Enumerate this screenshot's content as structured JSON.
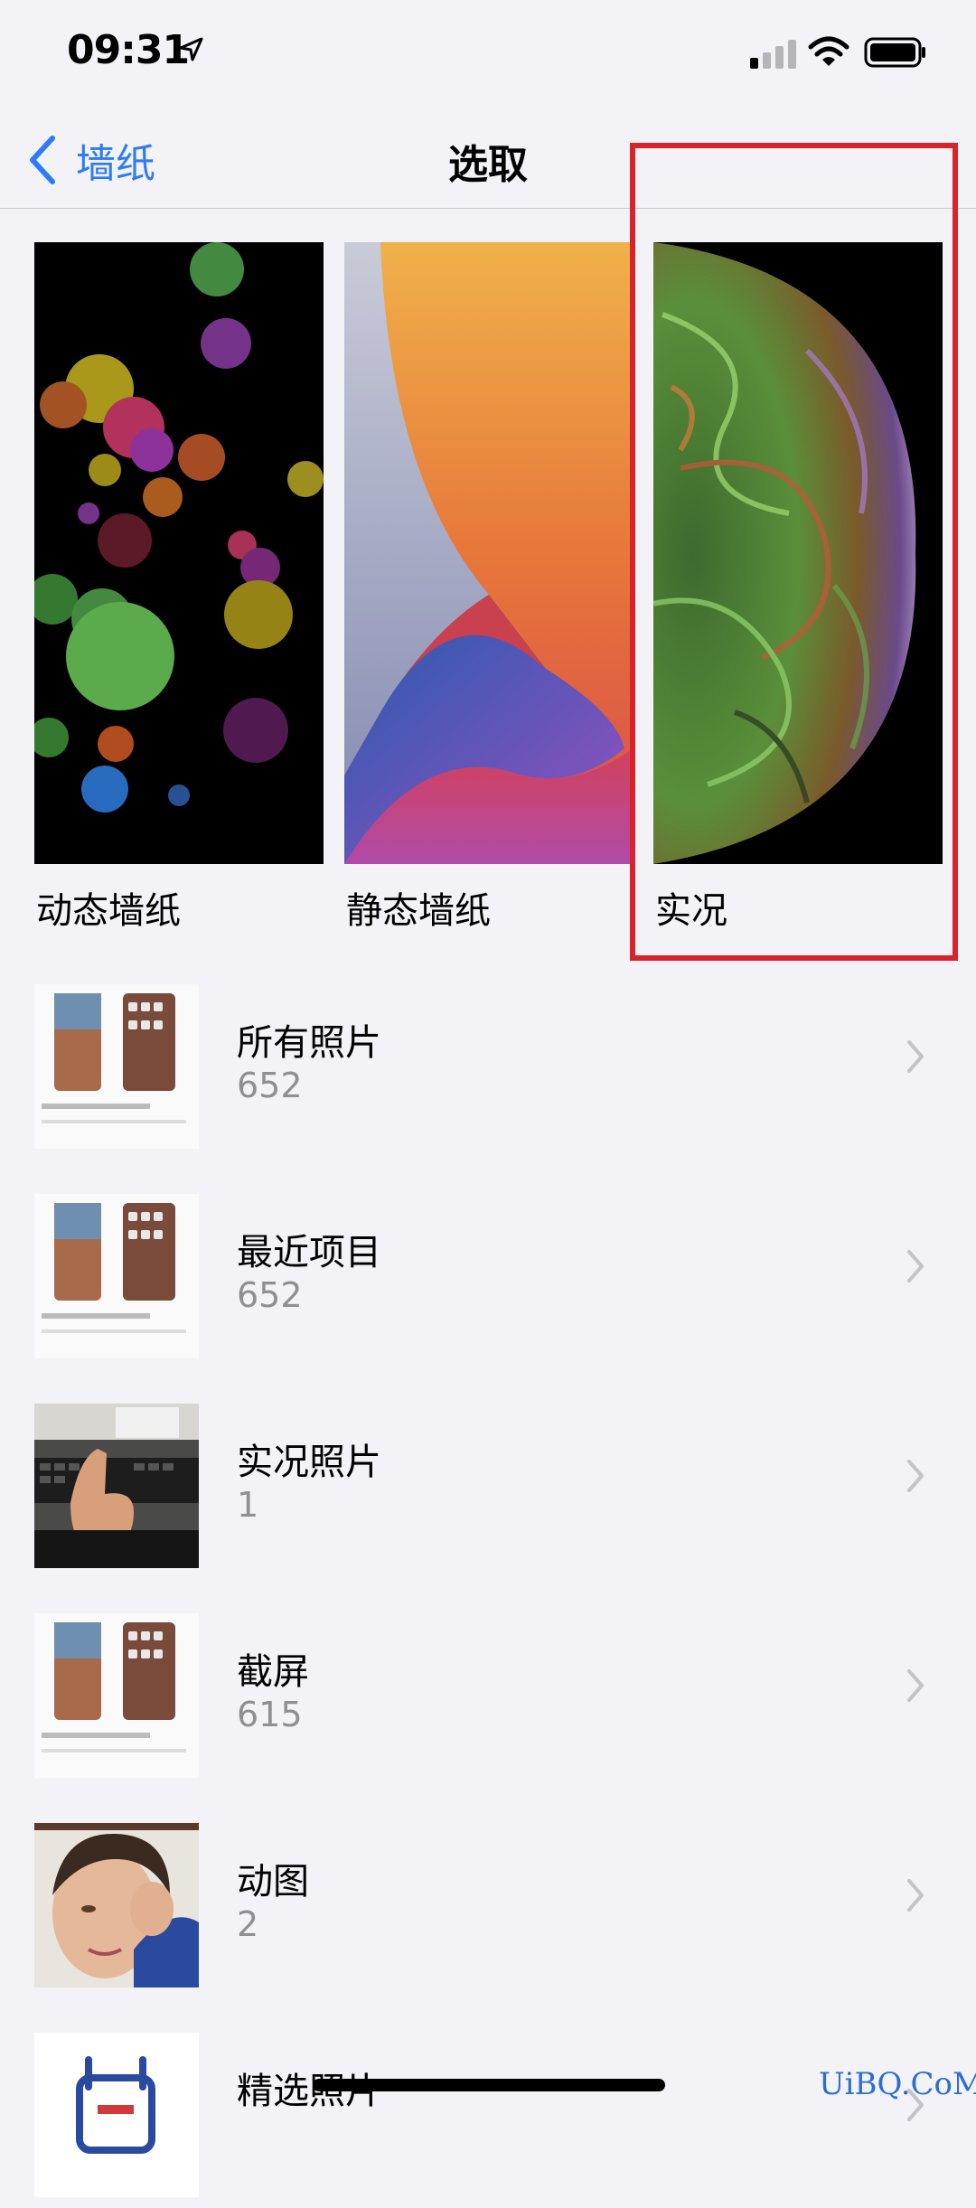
{
  "status_bar": {
    "time": "09:31"
  },
  "nav": {
    "back_label": "墙纸",
    "title": "选取"
  },
  "wallpapers": [
    {
      "label": "动态墙纸"
    },
    {
      "label": "静态墙纸"
    },
    {
      "label": "实况"
    }
  ],
  "albums": [
    {
      "title": "所有照片",
      "count": "652"
    },
    {
      "title": "最近项目",
      "count": "652"
    },
    {
      "title": "实况照片",
      "count": "1"
    },
    {
      "title": "截屏",
      "count": "615"
    },
    {
      "title": "动图",
      "count": "2"
    },
    {
      "title": "精选照片",
      "count": ""
    }
  ],
  "watermark": "UiBQ.CoM",
  "colors": {
    "accent": "#2d7bf6",
    "highlight": "#d9232a",
    "background": "#f2f2f7"
  }
}
